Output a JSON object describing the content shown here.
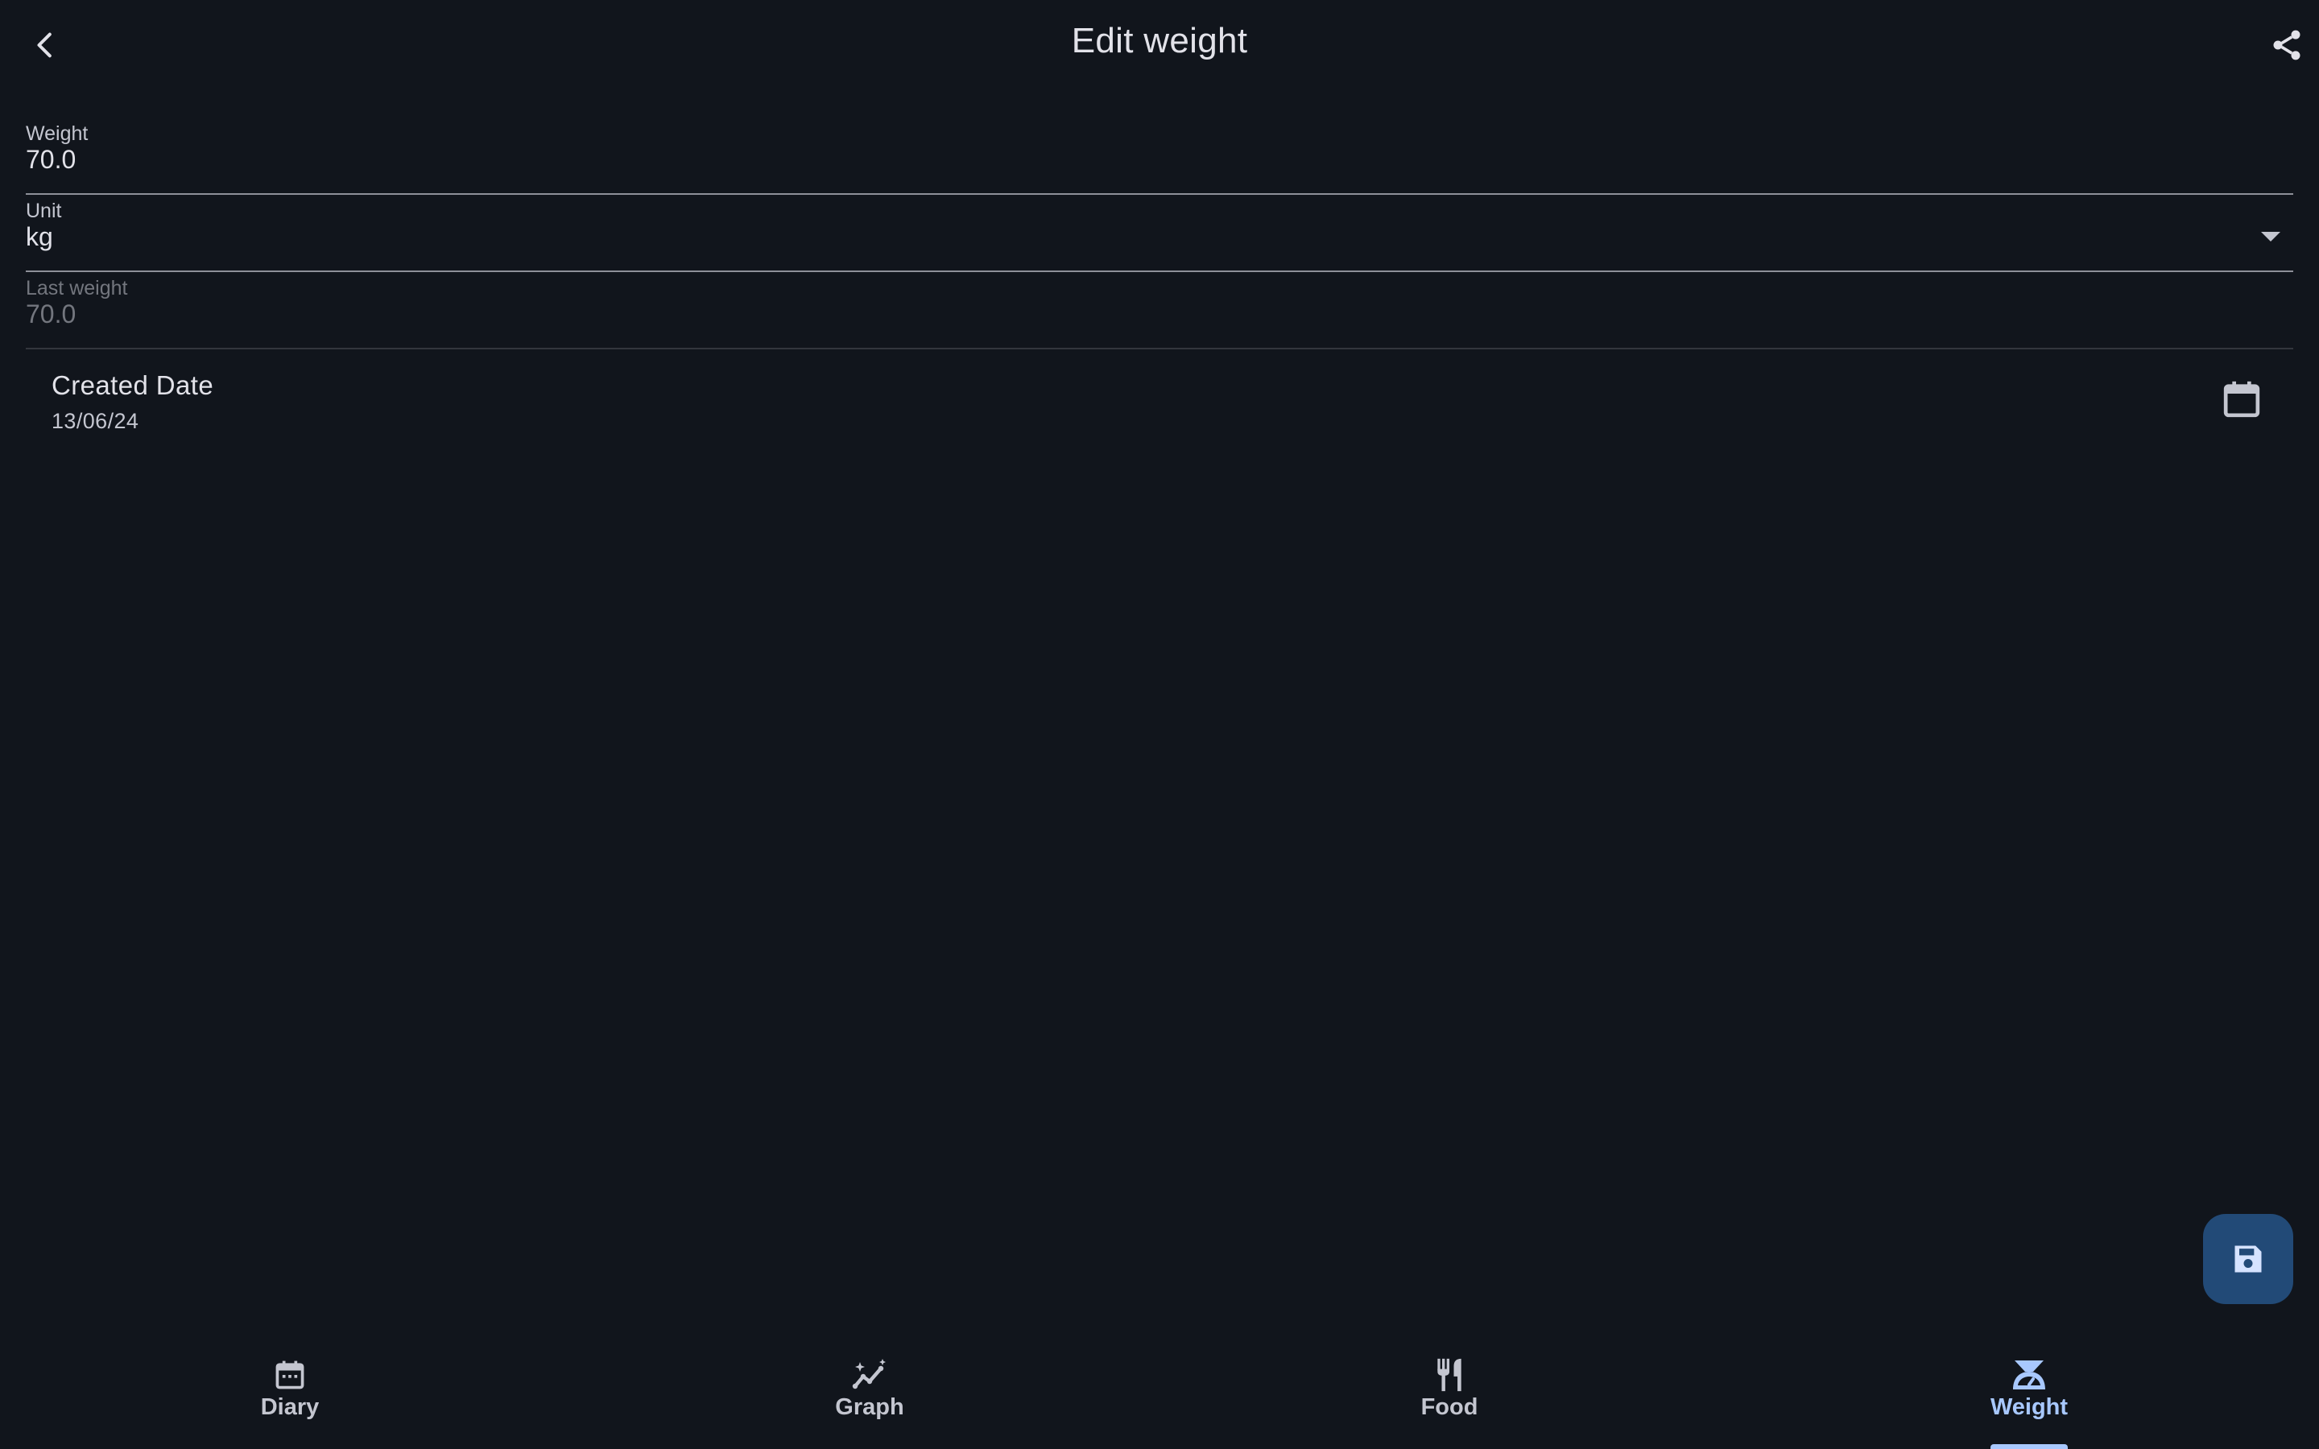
{
  "app": {
    "title": "Edit weight"
  },
  "form": {
    "weight": {
      "label": "Weight",
      "value": "70.0"
    },
    "unit": {
      "label": "Unit",
      "value": "kg"
    },
    "last_weight": {
      "label": "Last weight",
      "value": "70.0"
    },
    "created_date": {
      "label": "Created Date",
      "value": "13/06/24"
    }
  },
  "nav": {
    "items": [
      {
        "label": "Diary",
        "icon": "calendar-icon",
        "active": false
      },
      {
        "label": "Graph",
        "icon": "graph-sparkle-icon",
        "active": false
      },
      {
        "label": "Food",
        "icon": "utensils-icon",
        "active": false
      },
      {
        "label": "Weight",
        "icon": "scale-icon",
        "active": true
      }
    ]
  },
  "icons": {
    "back": "chevron-left-icon",
    "share": "share-icon",
    "dropdown": "caret-down-icon",
    "calendar": "calendar-icon",
    "save": "save-icon"
  },
  "colors": {
    "background": "#11151c",
    "accent": "#a8c8ff",
    "fab_background": "#224a77"
  }
}
